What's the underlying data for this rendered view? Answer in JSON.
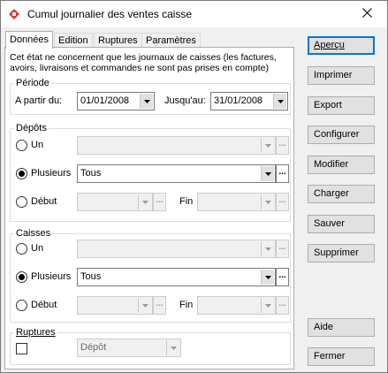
{
  "window": {
    "title": "Cumul journalier des ventes caisse"
  },
  "tabs": [
    {
      "label": "Données"
    },
    {
      "label": "Edition"
    },
    {
      "label": "Ruptures"
    },
    {
      "label": "Paramètres"
    }
  ],
  "note": "Cet état ne concernent que les journaux de caisses (les factures, avoirs, livraisons et commandes ne sont pas prises en compte)",
  "periode": {
    "legend": "Période",
    "from_label": "A partir du:",
    "from_value": "01/01/2008",
    "to_label": "Jusqu'au:",
    "to_value": "31/01/2008"
  },
  "depots": {
    "legend": "Dépôts",
    "un_label": "Un",
    "plusieurs_label": "Plusieurs",
    "plusieurs_value": "Tous",
    "debut_label": "Début",
    "fin_label": "Fin",
    "selected": "Plusieurs"
  },
  "caisses": {
    "legend": "Caisses",
    "un_label": "Un",
    "plusieurs_label": "Plusieurs",
    "plusieurs_value": "Tous",
    "debut_label": "Début",
    "fin_label": "Fin",
    "selected": "Plusieurs"
  },
  "ruptures": {
    "legend": "Ruptures",
    "checked": false,
    "combo_value": "Dépôt"
  },
  "buttons": {
    "apercu": "Aperçu",
    "imprimer": "Imprimer",
    "export": "Export",
    "configurer": "Configurer",
    "modifier": "Modifier",
    "charger": "Charger",
    "sauver": "Sauver",
    "supprimer": "Supprimer",
    "aide": "Aide",
    "fermer": "Fermer"
  },
  "misc": {
    "ellipsis": "..."
  },
  "colors": {
    "accent": "#0078d7",
    "window_bg": "#f0f0f0",
    "button_bg": "#e1e1e1"
  },
  "icons": {
    "app": "report-app-icon",
    "close": "close-icon",
    "dropdown": "chevron-down-icon"
  }
}
